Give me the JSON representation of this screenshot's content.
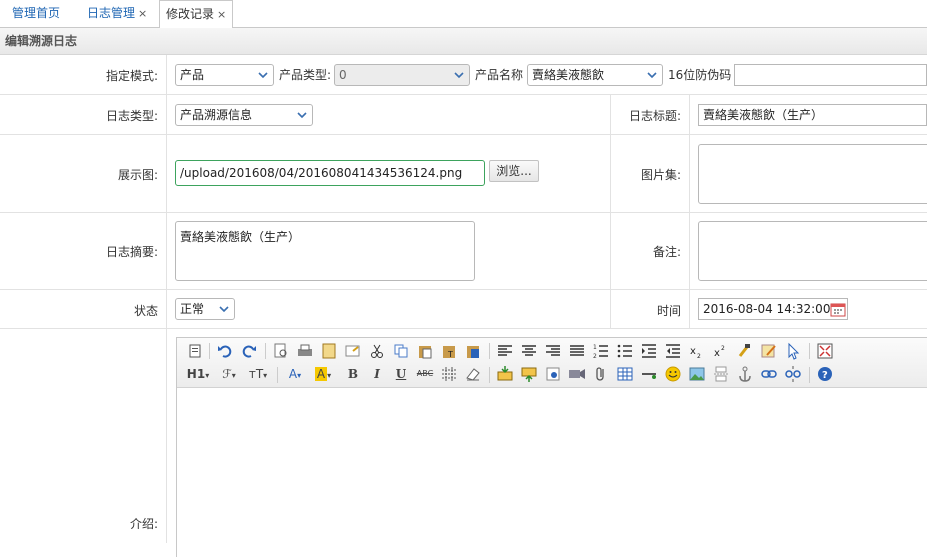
{
  "tabs": {
    "home": "管理首页",
    "log_manage": "日志管理",
    "edit_record": "修改记录",
    "close": "×"
  },
  "panel": {
    "title": "编辑溯源日志"
  },
  "form": {
    "mode": {
      "label": "指定模式:",
      "value": "产品"
    },
    "product_type": {
      "label": "产品类型:",
      "value": "0"
    },
    "product_name": {
      "label": "产品名称",
      "value": "賣絡美液態飲"
    },
    "code": {
      "label": "16位防伪码",
      "value": ""
    },
    "log_type": {
      "label": "日志类型:",
      "value": "产品溯源信息"
    },
    "log_title": {
      "label": "日志标题:",
      "value": "賣絡美液態飲（生产）"
    },
    "display_image": {
      "label": "展示图:",
      "value": "/upload/201608/04/201608041434536124.png",
      "browse": "浏览..."
    },
    "image_set": {
      "label": "图片集:",
      "value": ""
    },
    "summary": {
      "label": "日志摘要:",
      "value": "賣絡美液態飲（生产）"
    },
    "remark": {
      "label": "备注:",
      "value": ""
    },
    "status": {
      "label": "状态",
      "value": "正常"
    },
    "time": {
      "label": "时间",
      "value": "2016-08-04 14:32:00"
    },
    "intro": {
      "label": "介绍:"
    }
  },
  "toolbar": {
    "row1": [
      "source-icon",
      "undo-icon",
      "redo-icon",
      "preview-icon",
      "print-icon",
      "template-icon",
      "clear-format-icon",
      "cut-icon",
      "copy-icon",
      "paste-icon",
      "paste-text-icon",
      "paste-word-icon",
      "align-left-icon",
      "align-center-icon",
      "align-right-icon",
      "align-justify-icon",
      "ordered-list-icon",
      "unordered-list-icon",
      "indent-icon",
      "outdent-icon",
      "subscript-icon",
      "superscript-icon",
      "format-brush-icon",
      "quick-format-icon",
      "select-all-icon",
      "fullscreen-icon"
    ],
    "row2_labels": {
      "h1": "H1",
      "font": "ℱ",
      "size": "тT",
      "fore": "A",
      "back": "A",
      "bold": "B",
      "italic": "I",
      "underline": "U",
      "strike": "ABC"
    }
  },
  "colors": {
    "accent": "#1f66b3",
    "highlight": "#f5c800",
    "border": "#b8b8b8"
  }
}
